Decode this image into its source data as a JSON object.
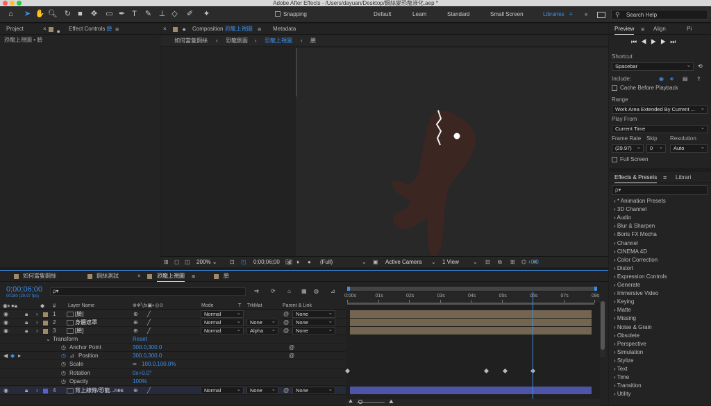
{
  "app": {
    "window_title": "Adobe After Effects - /Users/dayuan/Desktop/鋼絲變恐龍液化.aep *"
  },
  "toolbar": {
    "snapping_label": "Snapping",
    "workspaces": [
      "Default",
      "Learn",
      "Standard",
      "Small Screen",
      "Libraries"
    ],
    "active_workspace": "Libraries",
    "search_placeholder": "Search Help",
    "chevron": "»"
  },
  "left_panel": {
    "tabs": [
      "Project",
      "Effect Controls"
    ],
    "effect_controls_target": "臉",
    "breadcrumb": "恐龍上視圖 • 臉"
  },
  "comp_panel": {
    "tab_label": "Composition",
    "comp_name": "恐龍上視圖",
    "metadata_tab": "Metadata",
    "breadcrumbs": [
      "如何當隻鋼絲",
      "恐龍側面",
      "恐龍上視圖",
      "臉"
    ],
    "footer": {
      "zoom": "200%",
      "timecode": "0;00;06;00",
      "resolution": "(Full)",
      "camera": "Active Camera",
      "view": "1 View",
      "exposure": "+0.0"
    }
  },
  "preview_panel": {
    "tabs": [
      "Preview",
      "Align",
      "Pi"
    ],
    "shortcut_label": "Shortcut",
    "shortcut_value": "Spacebar",
    "include_label": "Include:",
    "cache_label": "Cache Before Playback",
    "range_label": "Range",
    "range_value": "Work Area Extended By Current ...",
    "playfrom_label": "Play From",
    "playfrom_value": "Current Time",
    "framerate_label": "Frame Rate",
    "skip_label": "Skip",
    "resolution_label": "Resolution",
    "framerate_value": "(29.97)",
    "skip_value": "0",
    "resolution_value": "Auto",
    "fullscreen_label": "Full Screen"
  },
  "effects_panel": {
    "tabs": [
      "Effects & Presets",
      "Librari"
    ],
    "search_placeholder": "ρ▾",
    "items": [
      "* Animation Presets",
      "3D Channel",
      "Audio",
      "Blur & Sharpen",
      "Boris FX Mocha",
      "Channel",
      "CINEMA 4D",
      "Color Correction",
      "Distort",
      "Expression Controls",
      "Generate",
      "Immersive Video",
      "Keying",
      "Matte",
      "Missing",
      "Noise & Grain",
      "Obsolete",
      "Perspective",
      "Simulation",
      "Stylize",
      "Text",
      "Time",
      "Transition",
      "Utility"
    ]
  },
  "timeline": {
    "tabs": [
      "如何當隻鋼絲",
      "鋼絲測試",
      "恐龍上視圖",
      "臉"
    ],
    "active_tab": "恐龍上視圖",
    "timecode": "0;00;06;00",
    "frame_info": "00180 (29.97 fps)",
    "search_placeholder": "ρ▾",
    "columns": {
      "num": "#",
      "layer_name": "Layer Name",
      "mode": "Mode",
      "t": "T",
      "trkmat": "TrkMat",
      "parent": "Parent & Link"
    },
    "ruler": [
      "0:00s",
      "01s",
      "02s",
      "03s",
      "04s",
      "05s",
      "06s",
      "07s",
      "08s"
    ],
    "layers": [
      {
        "num": "1",
        "name": "[臉]",
        "mode": "Normal",
        "trkmat": "",
        "parent": "None",
        "color": "#9f8a6a"
      },
      {
        "num": "2",
        "name": "身體遮罩",
        "mode": "Normal",
        "trkmat": "None",
        "parent": "None",
        "color": "#9f8a6a"
      },
      {
        "num": "3",
        "name": "[臉]",
        "mode": "Normal",
        "trkmat": "Alpha",
        "parent": "None",
        "color": "#9f8a6a"
      },
      {
        "num": "4",
        "name": "背上線條/恐龍...nes",
        "mode": "Normal",
        "trkmat": "None",
        "parent": "None",
        "color": "#5a62c8"
      }
    ],
    "transform": {
      "label": "Transform",
      "reset": "Reset",
      "properties": [
        {
          "name": "Anchor Point",
          "value": "300.0,300.0"
        },
        {
          "name": "Position",
          "value": "300.0,300.0"
        },
        {
          "name": "Scale",
          "value": "100.0,100.0%"
        },
        {
          "name": "Rotation",
          "value": "0x+0.0°"
        },
        {
          "name": "Opacity",
          "value": "100%"
        }
      ]
    },
    "playhead_seconds": 6.0,
    "duration_seconds": 8.0
  }
}
